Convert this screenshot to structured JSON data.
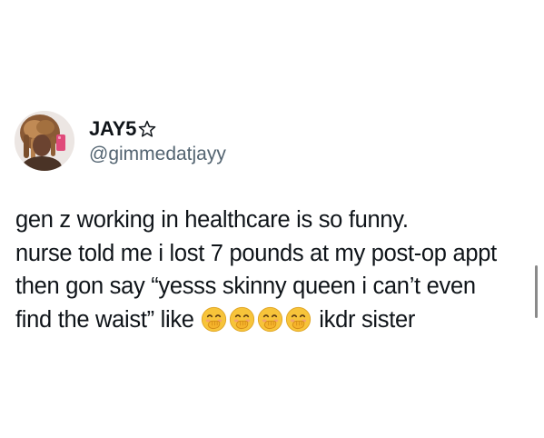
{
  "author": {
    "display_name": "JAY5",
    "badge_icon": "star-outline-icon",
    "handle": "@gimmedatjayy"
  },
  "post": {
    "line1": "gen z working in healthcare is so funny.",
    "line2": "nurse told me i lost 7 pounds at my post-op appt",
    "line3": "then gon say “yesss skinny queen i can’t even",
    "line4_prefix": "find the waist” like",
    "line4_emoji_count": 4,
    "line4_emoji_icon": "face-with-hand-over-mouth-icon",
    "line4_suffix": "ikdr sister"
  },
  "colors": {
    "text_primary": "#0f1419",
    "text_secondary": "#536471",
    "background": "#ffffff",
    "emoji_yellow": "#f7c43a"
  }
}
